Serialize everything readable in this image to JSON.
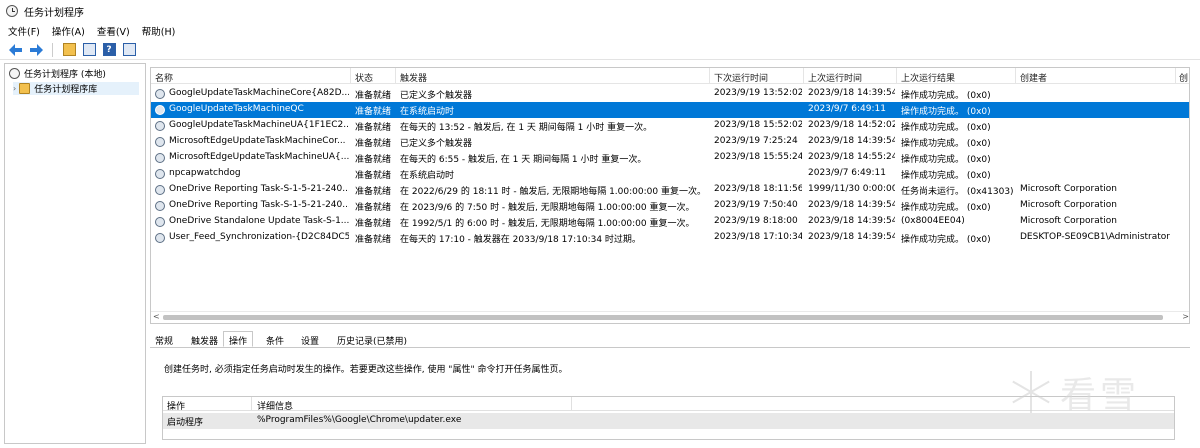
{
  "window": {
    "title": "任务计划程序"
  },
  "menu": [
    "文件(F)",
    "操作(A)",
    "查看(V)",
    "帮助(H)"
  ],
  "tree": {
    "root": "任务计划程序 (本地)",
    "child": "任务计划程序库",
    "expander": "›"
  },
  "table": {
    "headers": [
      "名称",
      "状态",
      "触发器",
      "下次运行时间",
      "上次运行时间",
      "上次运行结果",
      "创建者",
      "创"
    ],
    "rows": [
      {
        "name": "GoogleUpdateTaskMachineCore{A82D...",
        "status": "准备就绪",
        "trigger": "已定义多个触发器",
        "next": "2023/9/19 13:52:02",
        "last": "2023/9/18 14:39:54",
        "result": "操作成功完成。 (0x0)",
        "author": ""
      },
      {
        "name": "GoogleUpdateTaskMachineQC",
        "status": "准备就绪",
        "trigger": "在系统启动时",
        "next": "",
        "last": "2023/9/7 6:49:11",
        "result": "操作成功完成。 (0x0)",
        "author": ""
      },
      {
        "name": "GoogleUpdateTaskMachineUA{1F1EC2...",
        "status": "准备就绪",
        "trigger": "在每天的 13:52 - 触发后, 在 1 天 期间每隔 1 小时 重复一次。",
        "next": "2023/9/18 15:52:02",
        "last": "2023/9/18 14:52:02",
        "result": "操作成功完成。 (0x0)",
        "author": ""
      },
      {
        "name": "MicrosoftEdgeUpdateTaskMachineCor...",
        "status": "准备就绪",
        "trigger": "已定义多个触发器",
        "next": "2023/9/19 7:25:24",
        "last": "2023/9/18 14:39:54",
        "result": "操作成功完成。 (0x0)",
        "author": ""
      },
      {
        "name": "MicrosoftEdgeUpdateTaskMachineUA{...",
        "status": "准备就绪",
        "trigger": "在每天的 6:55 - 触发后, 在 1 天 期间每隔 1 小时 重复一次。",
        "next": "2023/9/18 15:55:24",
        "last": "2023/9/18 14:55:24",
        "result": "操作成功完成。 (0x0)",
        "author": ""
      },
      {
        "name": "npcapwatchdog",
        "status": "准备就绪",
        "trigger": "在系统启动时",
        "next": "",
        "last": "2023/9/7 6:49:11",
        "result": "操作成功完成。 (0x0)",
        "author": ""
      },
      {
        "name": "OneDrive Reporting Task-S-1-5-21-240...",
        "status": "准备就绪",
        "trigger": "在 2022/6/29 的 18:11 时 - 触发后, 无限期地每隔 1.00:00:00 重复一次。",
        "next": "2023/9/18 18:11:56",
        "last": "1999/11/30 0:00:00",
        "result": "任务尚未运行。 (0x41303)",
        "author": "Microsoft Corporation"
      },
      {
        "name": "OneDrive Reporting Task-S-1-5-21-240...",
        "status": "准备就绪",
        "trigger": "在 2023/9/6 的 7:50 时 - 触发后, 无限期地每隔 1.00:00:00 重复一次。",
        "next": "2023/9/19 7:50:40",
        "last": "2023/9/18 14:39:54",
        "result": "操作成功完成。 (0x0)",
        "author": "Microsoft Corporation"
      },
      {
        "name": "OneDrive Standalone Update Task-S-1...",
        "status": "准备就绪",
        "trigger": "在 1992/5/1 的 6:00 时 - 触发后, 无限期地每隔 1.00:00:00 重复一次。",
        "next": "2023/9/19 8:18:00",
        "last": "2023/9/18 14:39:54",
        "result": "(0x8004EE04)",
        "author": "Microsoft Corporation"
      },
      {
        "name": "User_Feed_Synchronization-{D2C84DC5...",
        "status": "准备就绪",
        "trigger": "在每天的 17:10 - 触发器在 2033/9/18 17:10:34 时过期。",
        "next": "2023/9/18 17:10:34",
        "last": "2023/9/18 14:39:54",
        "result": "操作成功完成。 (0x0)",
        "author": "DESKTOP-SE09CB1\\Administrator"
      }
    ]
  },
  "scroll": {
    "left": "<",
    "right": ">"
  },
  "detail": {
    "tabs": [
      "常规",
      "触发器",
      "操作",
      "条件",
      "设置",
      "历史记录(已禁用)"
    ],
    "description": "创建任务时, 必须指定任务启动时发生的操作。若要更改这些操作, 使用 \"属性\" 命令打开任务属性页。",
    "actions_headers": [
      "操作",
      "详细信息"
    ],
    "actions_row": {
      "action": "启动程序",
      "detail": "%ProgramFiles%\\Google\\Chrome\\updater.exe"
    }
  },
  "watermark": "看雪",
  "toolbar_help_glyph": "?"
}
